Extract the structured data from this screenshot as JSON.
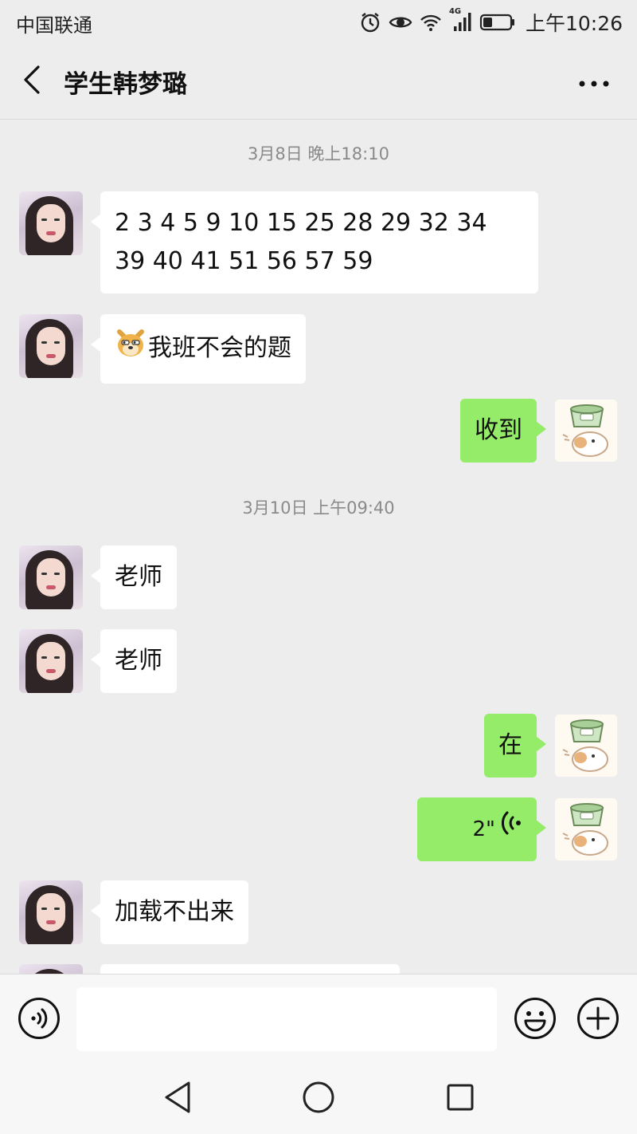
{
  "status_bar": {
    "carrier": "中国联通",
    "network_label": "4G",
    "time": "上午10:26"
  },
  "header": {
    "title": "学生韩梦璐",
    "back_icon": "chevron-left-icon",
    "more_icon": "ellipsis-icon"
  },
  "messages": [
    {
      "type": "timestamp",
      "text": "3月8日 晚上18:10"
    },
    {
      "type": "text",
      "side": "left",
      "sender": "学生韩梦璐",
      "text": "2 3 4 5 9 10 15 25 28 29 32 34 39 40 41 51 56 57 59"
    },
    {
      "type": "text",
      "side": "left",
      "sender": "学生韩梦璐",
      "emoji": "doge-emoji-icon",
      "text": "我班不会的题"
    },
    {
      "type": "text",
      "side": "right",
      "sender": "me",
      "text": "收到"
    },
    {
      "type": "timestamp",
      "text": "3月10日 上午09:40"
    },
    {
      "type": "text",
      "side": "left",
      "sender": "学生韩梦璐",
      "text": "老师"
    },
    {
      "type": "text",
      "side": "left",
      "sender": "学生韩梦璐",
      "text": "老师"
    },
    {
      "type": "text",
      "side": "right",
      "sender": "me",
      "text": "在"
    },
    {
      "type": "voice",
      "side": "right",
      "sender": "me",
      "duration": "2\""
    },
    {
      "type": "text",
      "side": "left",
      "sender": "学生韩梦璐",
      "text": "加载不出来"
    }
  ],
  "input_bar": {
    "voice_icon": "voice-mode-icon",
    "input_value": "",
    "emoji_icon": "smiley-icon",
    "plus_icon": "plus-circle-icon"
  },
  "nav_bar": {
    "back_icon": "triangle-back-icon",
    "home_icon": "circle-home-icon",
    "recents_icon": "square-recents-icon"
  },
  "colors": {
    "background": "#ededed",
    "sent_bubble": "#95ec69",
    "received_bubble": "#ffffff",
    "timestamp_text": "#8a8a8a"
  }
}
